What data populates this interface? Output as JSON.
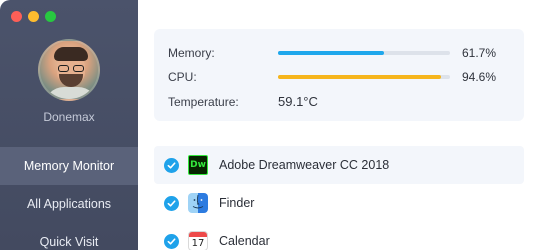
{
  "sidebar": {
    "username": "Donemax",
    "nav": [
      {
        "label": "Memory Monitor",
        "active": true
      },
      {
        "label": "All Applications",
        "active": false
      },
      {
        "label": "Quick Visit",
        "active": false
      }
    ]
  },
  "stats": {
    "memory": {
      "label": "Memory:",
      "value": "61.7%",
      "percent": 61.7,
      "color": "#1ea7ec"
    },
    "cpu": {
      "label": "CPU:",
      "value": "94.6%",
      "percent": 94.6,
      "color": "#f6b51c"
    },
    "temperature": {
      "label": "Temperature:",
      "value": "59.1°C"
    }
  },
  "apps": [
    {
      "name": "Adobe Dreamweaver CC 2018",
      "icon": "dreamweaver-icon",
      "icon_text": "Dw",
      "checked": true
    },
    {
      "name": "Finder",
      "icon": "finder-icon",
      "checked": true
    },
    {
      "name": "Calendar",
      "icon": "calendar-icon",
      "icon_text": "17",
      "checked": true
    }
  ],
  "colors": {
    "sidebar": "#4b536b",
    "accent": "#1fa2ea",
    "panel": "#f3f6fb"
  }
}
